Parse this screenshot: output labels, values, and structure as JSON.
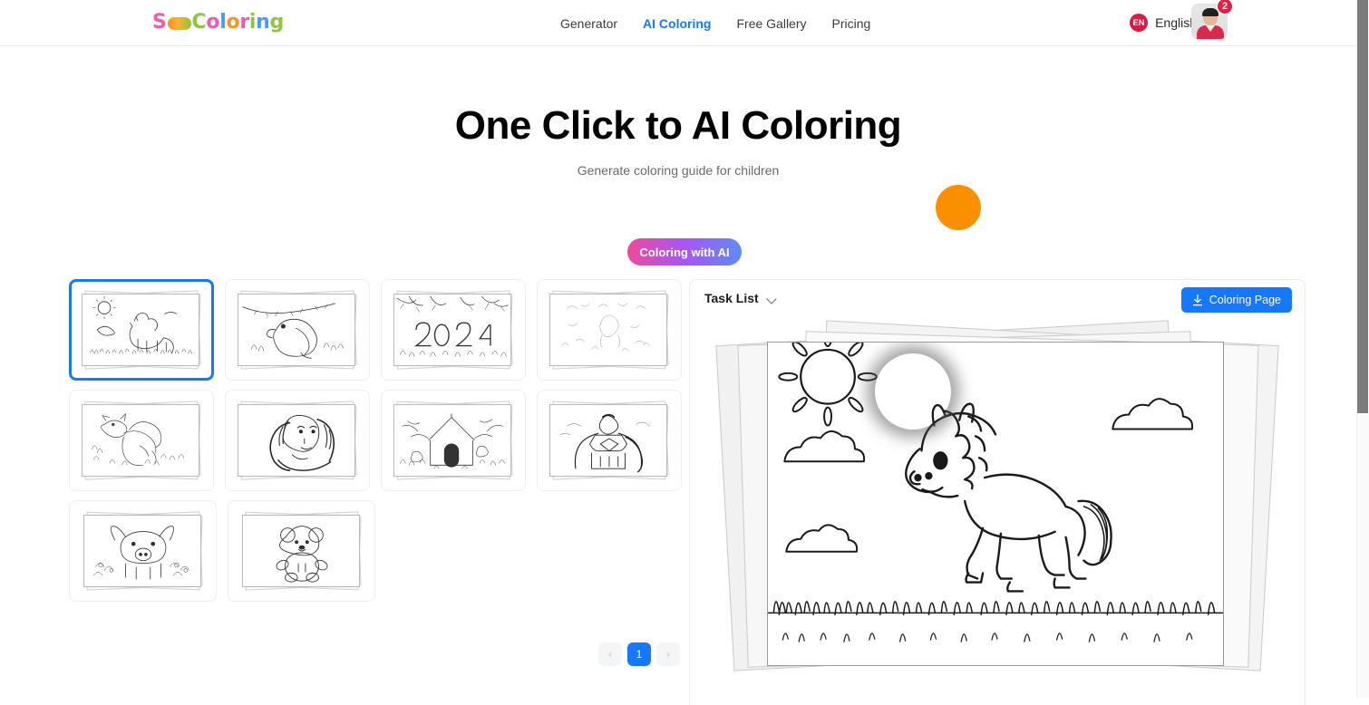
{
  "header": {
    "logo": {
      "prefix": "S",
      "icon": "crayon-icon",
      "suffix": "Coloring"
    },
    "nav": [
      {
        "label": "Generator",
        "active": false
      },
      {
        "label": "AI Coloring",
        "active": true
      },
      {
        "label": "Free Gallery",
        "active": false
      },
      {
        "label": "Pricing",
        "active": false
      }
    ],
    "language": {
      "code": "EN",
      "label": "English"
    },
    "account": {
      "notification_count": "2"
    }
  },
  "hero": {
    "title": "One Click to AI Coloring",
    "subtitle": "Generate coloring guide for children",
    "cta_label": "Coloring with AI",
    "accent_dot_color": "#fa9000"
  },
  "gallery": {
    "items": [
      {
        "name": "horse-in-meadow",
        "selected": true
      },
      {
        "name": "parrot-on-branch",
        "selected": false
      },
      {
        "name": "2024-new-year",
        "selected": false
      },
      {
        "name": "faint-sketch",
        "selected": false
      },
      {
        "name": "dragon",
        "selected": false
      },
      {
        "name": "woman-portrait",
        "selected": false
      },
      {
        "name": "cottage-house",
        "selected": false
      },
      {
        "name": "superhero",
        "selected": false
      },
      {
        "name": "pig-in-flowers",
        "selected": false
      },
      {
        "name": "teddy-bear",
        "selected": false
      }
    ]
  },
  "pagination": {
    "prev": "‹",
    "next": "›",
    "pages": [
      "1"
    ],
    "current": "1"
  },
  "task_panel": {
    "title": "Task List",
    "download_label": "Coloring Page",
    "preview_name": "horse-coloring-page"
  },
  "colors": {
    "accent_blue": "#1677ff",
    "badge_red": "#e1223f",
    "lang_badge": "#d81b43"
  }
}
